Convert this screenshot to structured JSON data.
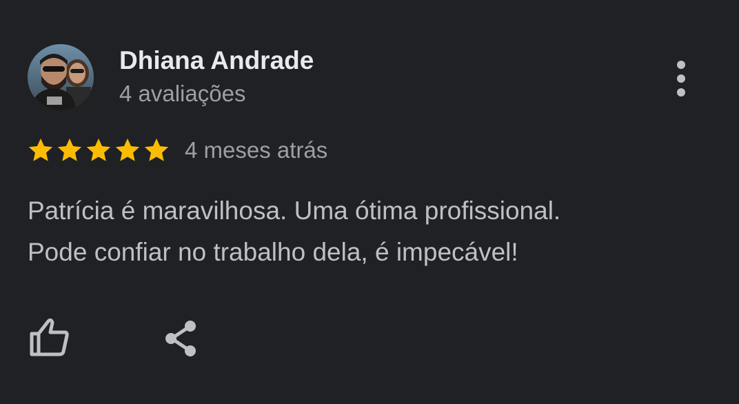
{
  "review": {
    "author": {
      "name": "Dhiana Andrade",
      "review_count": "4 avaliações",
      "avatar_icon": "profile-photo"
    },
    "rating": {
      "stars": 5,
      "max": 5,
      "star_color": "#fbbc04"
    },
    "date": "4 meses atrás",
    "text": "Patrícia é maravilhosa. Uma ótima profissional.\nPode confiar no trabalho dela, é impecável!",
    "actions": {
      "more_icon": "more-vert-icon",
      "like_icon": "thumb-up-icon",
      "share_icon": "share-icon"
    }
  },
  "colors": {
    "background": "#202124",
    "name": "#e8eaed",
    "secondary_text": "#9aa0a6",
    "body_text": "#bdc1c6",
    "icon": "#bdc1c6"
  }
}
